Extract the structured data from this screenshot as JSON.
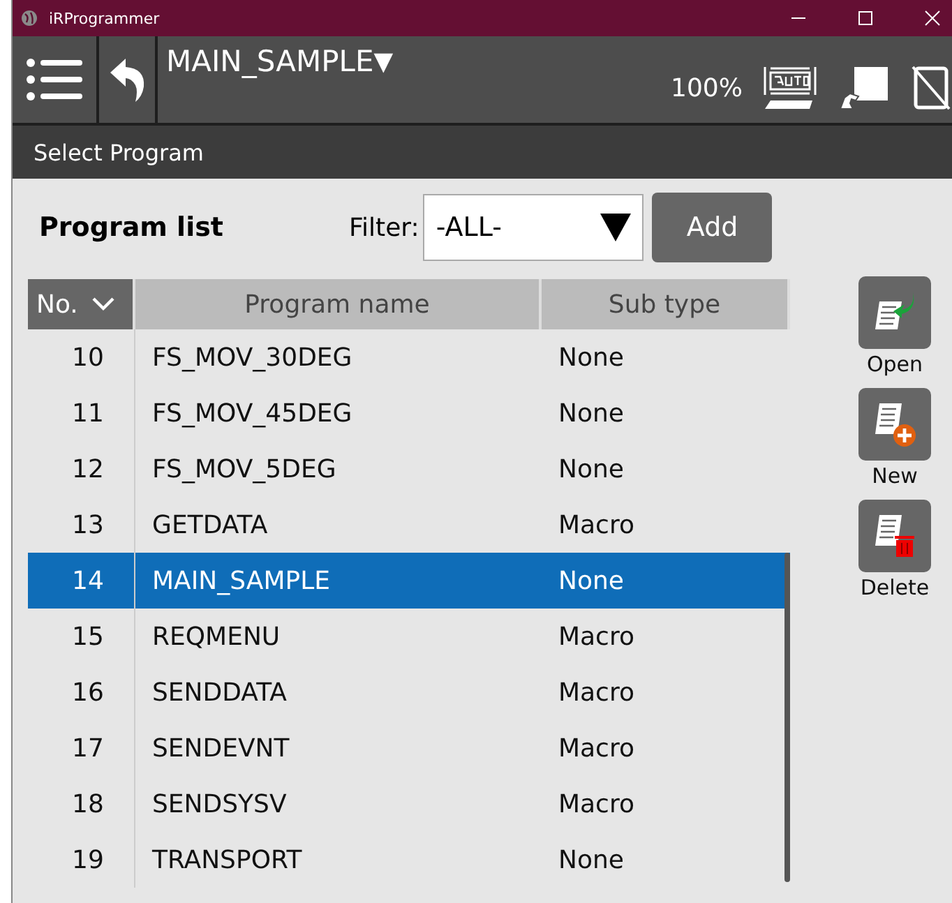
{
  "window": {
    "title": "iRProgrammer"
  },
  "toolbar": {
    "program": "MAIN_SAMPLE",
    "program_caret": "▼",
    "speed": "100%"
  },
  "heading": "Select Program",
  "program_list": {
    "label": "Program list",
    "filter_label": "Filter:",
    "filter_value": "-ALL-",
    "add_button": "Add"
  },
  "table": {
    "columns": [
      {
        "label": "No.",
        "sorted": true
      },
      {
        "label": "Program name",
        "sorted": false
      },
      {
        "label": "Sub type",
        "sorted": false
      }
    ],
    "rows": [
      {
        "no": "10",
        "name": "FS_MOV_30DEG",
        "sub_type": "None",
        "selected": false
      },
      {
        "no": "11",
        "name": "FS_MOV_45DEG",
        "sub_type": "None",
        "selected": false
      },
      {
        "no": "12",
        "name": "FS_MOV_5DEG",
        "sub_type": "None",
        "selected": false
      },
      {
        "no": "13",
        "name": "GETDATA",
        "sub_type": "Macro",
        "selected": false
      },
      {
        "no": "14",
        "name": "MAIN_SAMPLE",
        "sub_type": "None",
        "selected": true
      },
      {
        "no": "15",
        "name": "REQMENU",
        "sub_type": "Macro",
        "selected": false
      },
      {
        "no": "16",
        "name": "SENDDATA",
        "sub_type": "Macro",
        "selected": false
      },
      {
        "no": "17",
        "name": "SENDEVNT",
        "sub_type": "Macro",
        "selected": false
      },
      {
        "no": "18",
        "name": "SENDSYSV",
        "sub_type": "Macro",
        "selected": false
      },
      {
        "no": "19",
        "name": "TRANSPORT",
        "sub_type": "None",
        "selected": false
      }
    ]
  },
  "actions": [
    {
      "kind": "open",
      "label": "Open"
    },
    {
      "kind": "new",
      "label": "New"
    },
    {
      "kind": "delete",
      "label": "Delete"
    }
  ]
}
